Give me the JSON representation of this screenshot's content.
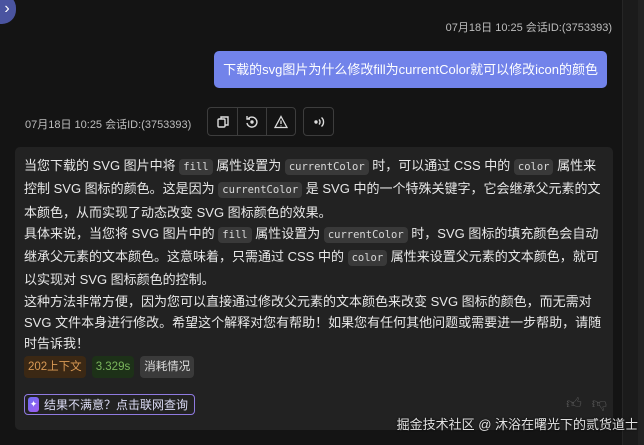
{
  "sidebar_toggle_icon": "chevron-right-icon",
  "user_message": {
    "timestamp": "07月18日 10:25 会话ID:(3753393)",
    "text": "下载的svg图片为什么修改fill为currentColor就可以修改icon的颜色"
  },
  "assistant_message": {
    "timestamp": "07月18日 10:25 会话ID:(3753393)",
    "actions": [
      "copy-icon",
      "regenerate-icon",
      "report-icon",
      "read-aloud-icon"
    ],
    "paragraphs": [
      [
        {
          "t": "当您下载的 SVG 图片中将 "
        },
        {
          "c": "fill"
        },
        {
          "t": " 属性设置为 "
        },
        {
          "c": "currentColor"
        },
        {
          "t": " 时，可以通过 CSS 中的 "
        },
        {
          "c": "color"
        },
        {
          "t": " 属性来控制 SVG 图标的颜色。这是因为 "
        },
        {
          "c": "currentColor"
        },
        {
          "t": " 是 SVG 中的一个特殊关键字，它会继承父元素的文本颜色，从而实现了动态改变 SVG 图标颜色的效果。"
        }
      ],
      [
        {
          "t": "具体来说，当您将 SVG 图片中的 "
        },
        {
          "c": "fill"
        },
        {
          "t": " 属性设置为 "
        },
        {
          "c": "currentColor"
        },
        {
          "t": " 时，SVG 图标的填充颜色会自动继承父元素的文本颜色。这意味着，只需通过 CSS 中的 "
        },
        {
          "c": "color"
        },
        {
          "t": " 属性来设置父元素的文本颜色，就可以实现对 SVG 图标颜色的控制。"
        }
      ],
      [
        {
          "t": "这种方法非常方便，因为您可以直接通过修改父元素的文本颜色来改变 SVG 图标的颜色，而无需对 SVG 文件本身进行修改。希望这个解释对您有帮助！如果您有任何其他问题或需要进一步帮助，请随时告诉我！"
        }
      ]
    ],
    "badges": {
      "context": "202上下文",
      "time": "3.329s",
      "usage": "消耗情况"
    },
    "web_search_label": "结果不满意？点击联网查询"
  },
  "watermark": "掘金技术社区 @ 沐浴在曙光下的贰货道士"
}
